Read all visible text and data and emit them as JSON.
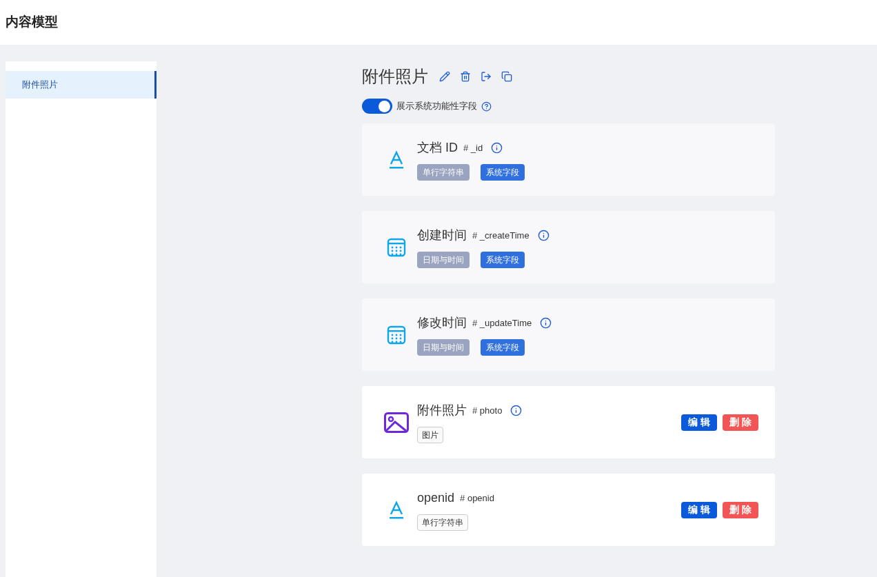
{
  "header": {
    "title": "内容模型"
  },
  "sidebar": {
    "items": [
      {
        "label": "附件照片",
        "selected": true
      }
    ]
  },
  "model": {
    "title": "附件照片",
    "show_system_fields": {
      "label": "展示系统功能性字段",
      "on": true
    }
  },
  "fields": [
    {
      "kind": "text",
      "system": true,
      "name": "文档 ID",
      "key": "# _id",
      "info": true,
      "tags": [
        "单行字符串",
        "系统字段"
      ]
    },
    {
      "kind": "date",
      "system": true,
      "name": "创建时间",
      "key": "# _createTime",
      "info": true,
      "tags": [
        "日期与时间",
        "系统字段"
      ]
    },
    {
      "kind": "date",
      "system": true,
      "name": "修改时间",
      "key": "# _updateTime",
      "info": true,
      "tags": [
        "日期与时间",
        "系统字段"
      ]
    },
    {
      "kind": "image",
      "system": false,
      "name": "附件照片",
      "key": "# photo",
      "info": true,
      "tags": [
        "图片"
      ],
      "actions": [
        "编 辑",
        "删 除"
      ]
    },
    {
      "kind": "text",
      "system": false,
      "name": "openid",
      "key": "# openid",
      "info": false,
      "tags": [
        "单行字符串"
      ],
      "actions": [
        "编 辑",
        "删 除"
      ]
    }
  ]
}
